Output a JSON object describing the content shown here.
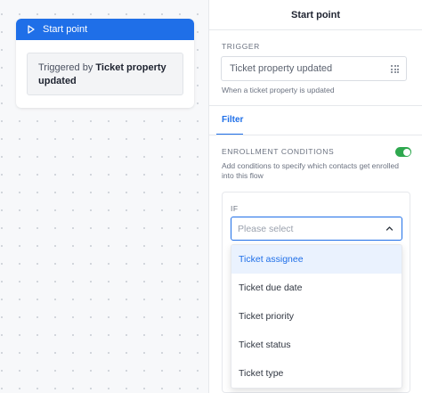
{
  "node": {
    "header_label": "Start point",
    "body_prefix": "Triggered by ",
    "body_strong": "Ticket property updated"
  },
  "panel": {
    "title": "Start point",
    "trigger_label": "TRIGGER",
    "trigger_value": "Ticket property updated",
    "trigger_help": "When a ticket property is updated",
    "tab_filter": "Filter",
    "enrollment_label": "ENROLLMENT CONDITIONS",
    "enrollment_enabled": true,
    "enrollment_help": "Add conditions to specify which contacts get enrolled into this flow",
    "if_label": "IF",
    "select_placeholder": "Please select",
    "options": [
      "Ticket assignee",
      "Ticket due date",
      "Ticket priority",
      "Ticket status",
      "Ticket type"
    ],
    "active_option_index": 0
  },
  "colors": {
    "accent": "#1f6fe8",
    "toggle_on": "#2fa84f",
    "option_highlight": "#eaf2fe"
  },
  "icons": {
    "node_header": "play-icon",
    "trigger_picker": "grid-dots-icon",
    "select": "chevron-up-icon"
  }
}
